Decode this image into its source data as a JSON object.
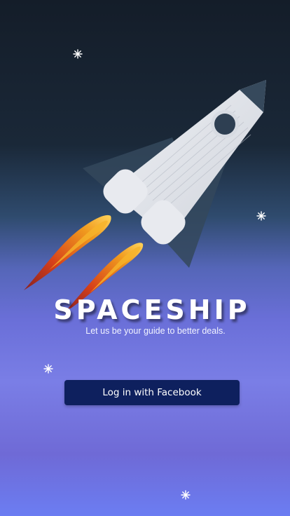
{
  "app": {
    "title": "SPACESHIP",
    "tagline": "Let us be your guide to better deals."
  },
  "actions": {
    "facebook_login_label": "Log in with Facebook"
  },
  "icons": {
    "hero": "rocket-icon",
    "decoration": "star-icon"
  },
  "colors": {
    "button_background": "#0e205e",
    "button_text": "#ffffff",
    "title_text": "#ffffff"
  }
}
